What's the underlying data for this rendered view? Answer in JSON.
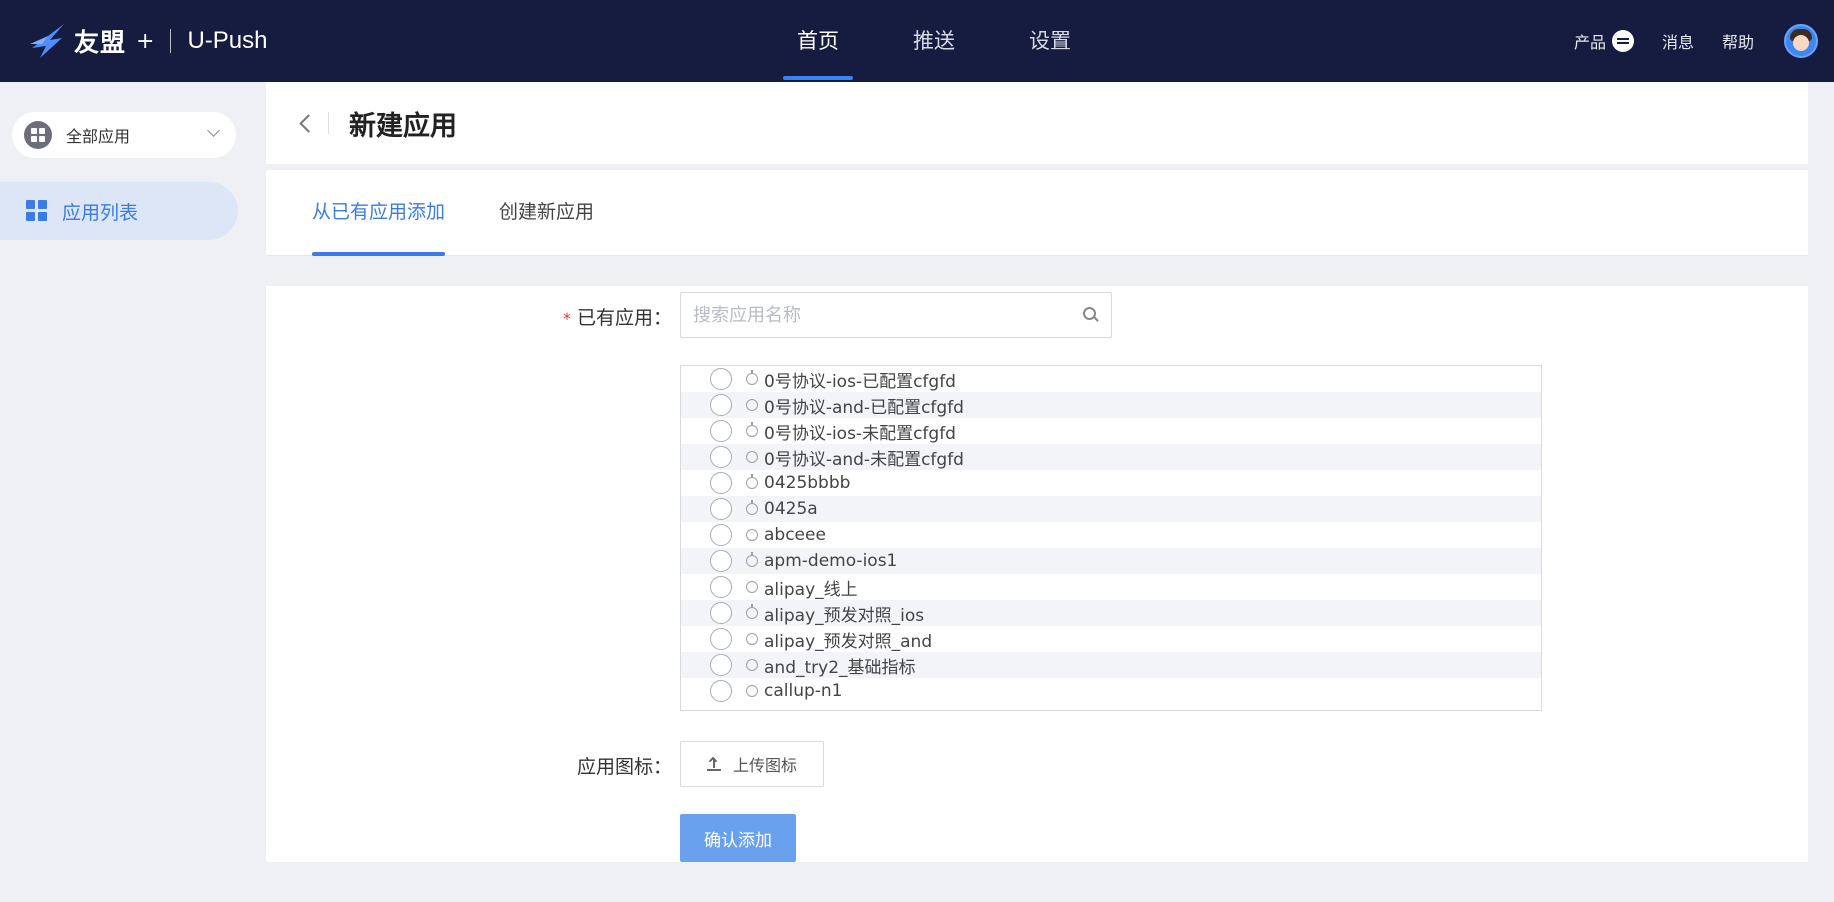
{
  "topbar": {
    "brand_name": "友盟",
    "brand_plus": "+",
    "brand_product": "U-Push",
    "nav": [
      {
        "label": "首页",
        "active": true
      },
      {
        "label": "推送",
        "active": false
      },
      {
        "label": "设置",
        "active": false
      }
    ],
    "right": {
      "product": "产品",
      "messages": "消息",
      "help": "帮助"
    }
  },
  "sidebar": {
    "app_select": "全部应用",
    "items": [
      {
        "label": "应用列表",
        "active": true
      }
    ]
  },
  "header": {
    "title": "新建应用"
  },
  "tabs": [
    {
      "label": "从已有应用添加",
      "active": true
    },
    {
      "label": "创建新应用",
      "active": false
    }
  ],
  "form": {
    "required_mark": "*",
    "existing_label": "已有应用：",
    "search_placeholder": "搜索应用名称",
    "apps": [
      {
        "name": "0号协议-ios-已配置cfgfd",
        "os": "ios"
      },
      {
        "name": "0号协议-and-已配置cfgfd",
        "os": "android"
      },
      {
        "name": "0号协议-ios-未配置cfgfd",
        "os": "ios"
      },
      {
        "name": "0号协议-and-未配置cfgfd",
        "os": "android"
      },
      {
        "name": "0425bbbb",
        "os": "ios"
      },
      {
        "name": "0425a",
        "os": "ios"
      },
      {
        "name": "abceee",
        "os": "android"
      },
      {
        "name": "apm-demo-ios1",
        "os": "ios"
      },
      {
        "name": "alipay_线上",
        "os": "android"
      },
      {
        "name": "alipay_预发对照_ios",
        "os": "ios"
      },
      {
        "name": "alipay_预发对照_and",
        "os": "android"
      },
      {
        "name": "and_try2_基础指标",
        "os": "android"
      },
      {
        "name": "callup-n1",
        "os": "android"
      }
    ],
    "icon_label": "应用图标：",
    "upload_label": "上传图标",
    "confirm_label": "确认添加"
  },
  "colors": {
    "topbar_bg": "#151c3f",
    "accent": "#3a7be8",
    "confirm_bg": "#6aa1ee",
    "required": "#e03c31"
  }
}
